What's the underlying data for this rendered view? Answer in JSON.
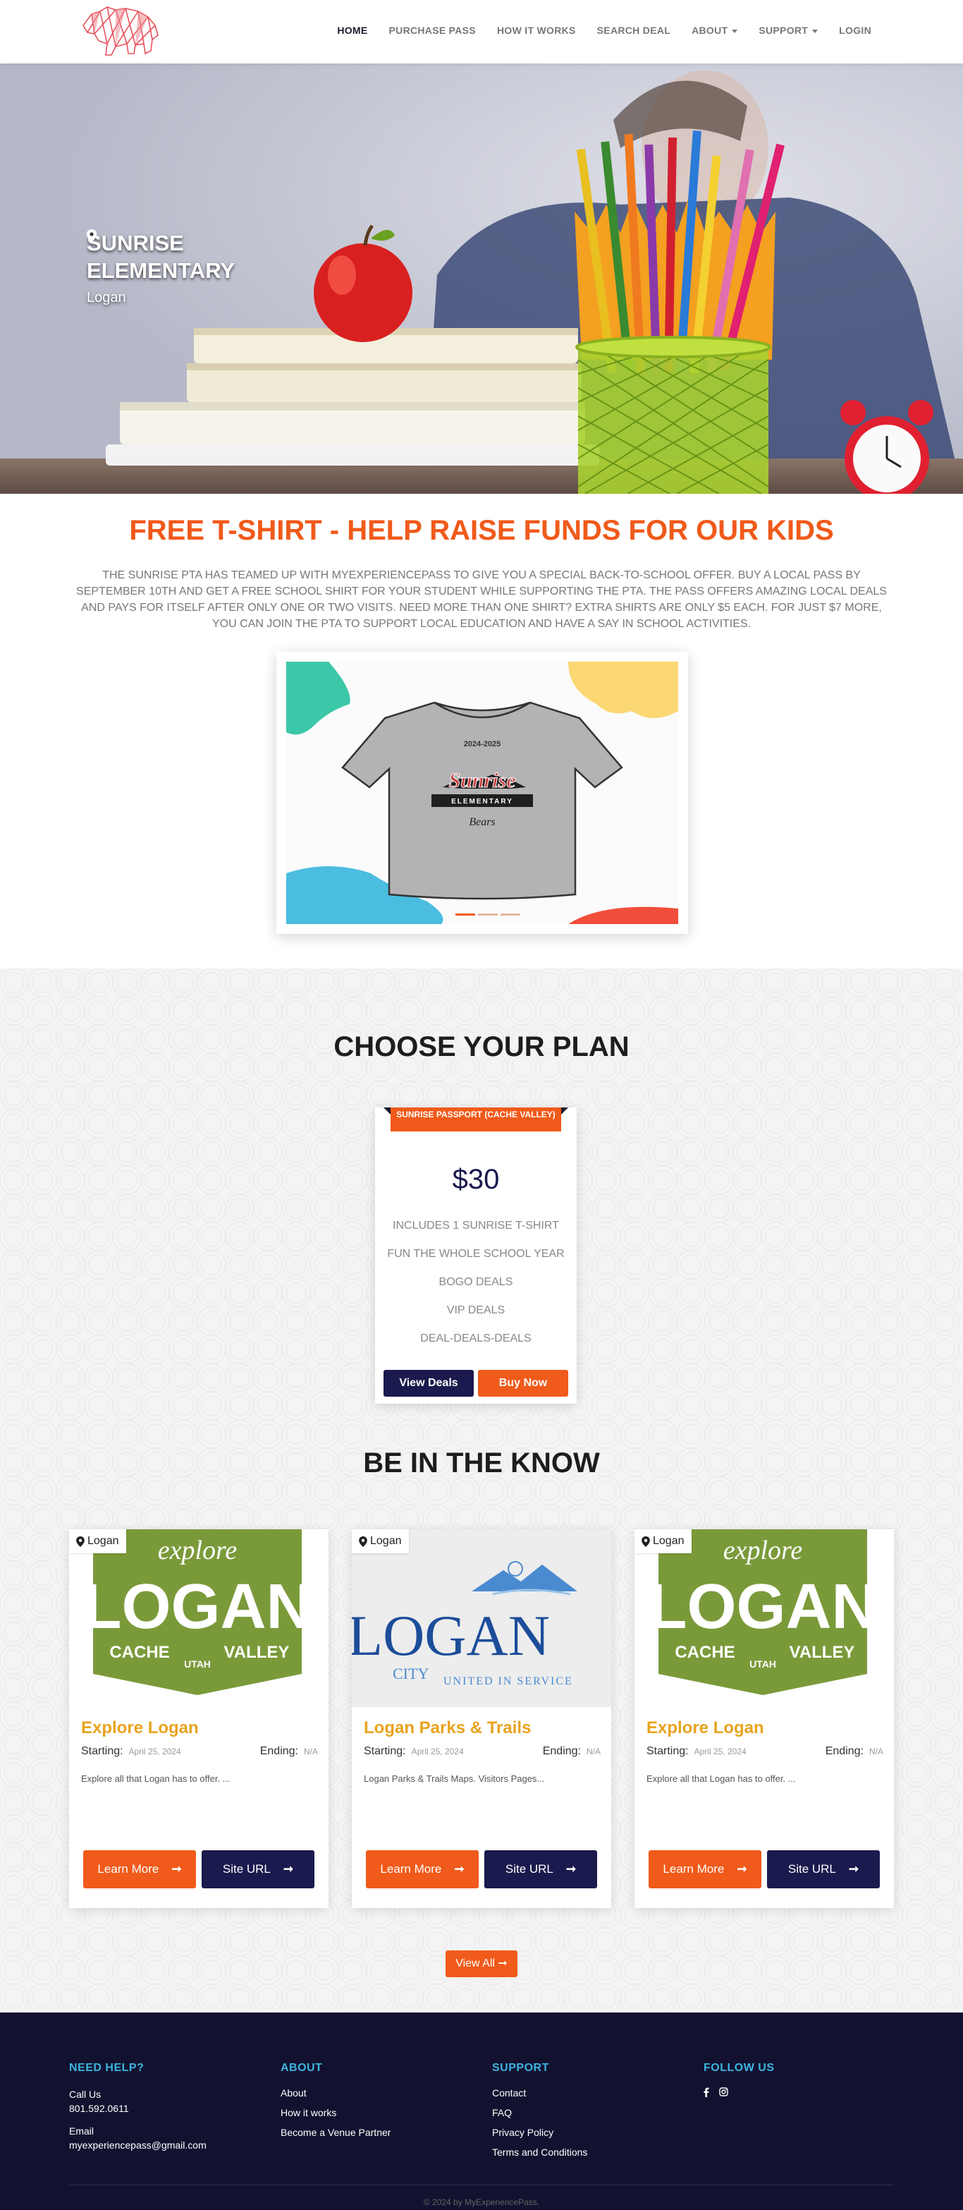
{
  "nav": {
    "logo_name": "bear-logo",
    "items": [
      {
        "label": "HOME",
        "active": true,
        "dropdown": false
      },
      {
        "label": "PURCHASE PASS",
        "active": false,
        "dropdown": false
      },
      {
        "label": "HOW IT WORKS",
        "active": false,
        "dropdown": false
      },
      {
        "label": "SEARCH DEAL",
        "active": false,
        "dropdown": false
      },
      {
        "label": "ABOUT",
        "active": false,
        "dropdown": true
      },
      {
        "label": "SUPPORT",
        "active": false,
        "dropdown": true
      },
      {
        "label": "LOGIN",
        "active": false,
        "dropdown": false
      }
    ]
  },
  "hero": {
    "title": "SUNRISE ELEMENTARY",
    "location": "Logan"
  },
  "promo": {
    "title": "FREE T-SHIRT - HELP RAISE FUNDS FOR OUR KIDS",
    "text": "The Sunrise PTA has teamed up with MyExperiencePass to give you a special back-to-school offer. Buy a local pass by September 10th and get a free school shirt for your student while supporting the PTA. The pass offers amazing local deals and pays for itself after only one or two visits. Need more than one shirt? Extra shirts are only $5 each. For just $7 more, you can join the PTA to support local education and have a say in school activities.",
    "shirt": {
      "years": "2024-2025",
      "school": "Sunrise",
      "sub": "ELEMENTARY",
      "mascot": "Bears"
    },
    "active_slide": 0,
    "slide_count": 3
  },
  "plans": {
    "title": "CHOOSE YOUR PLAN",
    "card": {
      "name": "SUNRISE PASSPORT (CACHE VALLEY)",
      "price": "$30",
      "features": [
        "INCLUDES 1 SUNRISE T-SHIRT",
        "FUN THE WHOLE SCHOOL YEAR",
        "BOGO DEALS",
        "VIP DEALS",
        "DEAL-DEALS-DEALS"
      ],
      "view_label": "View Deals",
      "buy_label": "Buy Now"
    }
  },
  "news": {
    "title": "BE IN THE KNOW",
    "starting_label": "Starting:",
    "ending_label": "Ending:",
    "learn_label": "Learn More",
    "site_label": "Site URL",
    "cards": [
      {
        "location": "Logan",
        "title": "Explore Logan",
        "start": "April 25, 2024",
        "end": "N/A",
        "desc": "Explore all that Logan has to offer. ...",
        "image": "explore-logan",
        "badge": {
          "top": "explore",
          "main": "LOGAN",
          "left": "CACHE",
          "mid": "UTAH",
          "right": "VALLEY"
        }
      },
      {
        "location": "Logan",
        "title": "Logan Parks & Trails",
        "start": "April 25, 2024",
        "end": "N/A",
        "desc": "Logan Parks & Trails Maps. Visitors Pages...",
        "image": "logan-city",
        "badge": {
          "main": "LOGAN",
          "left": "CITY",
          "right": "UNITED IN SERVICE"
        }
      },
      {
        "location": "Logan",
        "title": "Explore Logan",
        "start": "April 25, 2024",
        "end": "N/A",
        "desc": "Explore all that Logan has to offer. ...",
        "image": "explore-logan",
        "badge": {
          "top": "explore",
          "main": "LOGAN",
          "left": "CACHE",
          "mid": "UTAH",
          "right": "VALLEY"
        }
      }
    ],
    "view_all_label": "View All"
  },
  "footer": {
    "help": {
      "title": "NEED HELP?",
      "call_label": "Call Us",
      "phone": "801.592.0611",
      "email_label": "Email",
      "email": "myexperiencepass@gmail.com"
    },
    "about": {
      "title": "ABOUT",
      "links": [
        "About",
        "How it works",
        "Become a Venue Partner"
      ]
    },
    "support": {
      "title": "SUPPORT",
      "links": [
        "Contact",
        "FAQ",
        "Privacy Policy",
        "Terms and Conditions"
      ]
    },
    "follow": {
      "title": "FOLLOW US",
      "icons": [
        "facebook-icon",
        "instagram-icon"
      ]
    },
    "copyright": "© 2024 by MyExperiencePass."
  },
  "colors": {
    "accent": "#f05a1a",
    "navy": "#1a1a4e",
    "footer_bg": "#121230",
    "footer_heading": "#3db4e0",
    "news_title": "#e8a31e",
    "logan_green": "#7a9a3a"
  }
}
